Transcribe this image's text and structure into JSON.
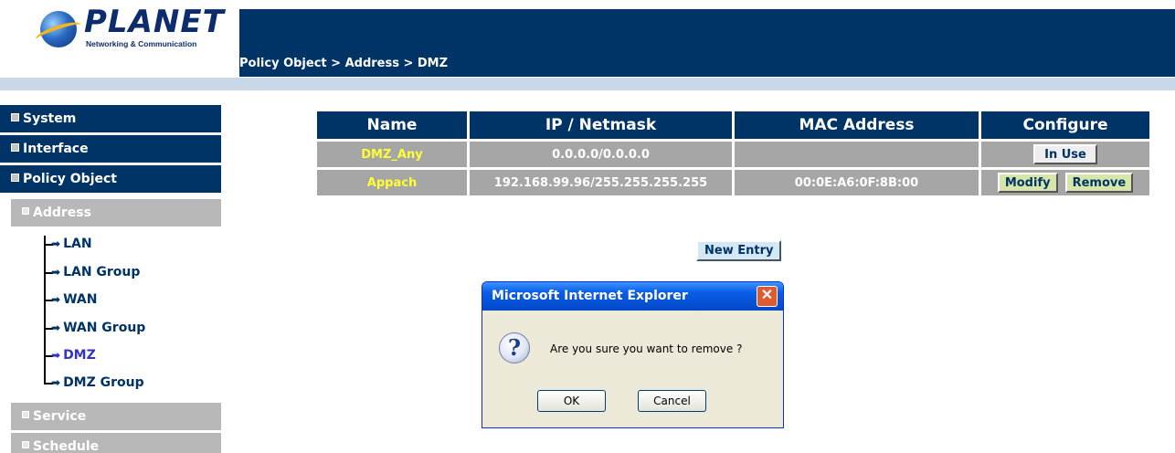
{
  "logo": {
    "brand": "PLANET",
    "tagline": "Networking & Communication"
  },
  "header": {
    "breadcrumb": "Policy Object > Address > DMZ"
  },
  "sidebar": {
    "main_items": [
      {
        "label": "System"
      },
      {
        "label": "Interface"
      },
      {
        "label": "Policy Object"
      }
    ],
    "sub_items": [
      {
        "label": "Address"
      },
      {
        "label": "Service"
      },
      {
        "label": "Schedule"
      }
    ],
    "tree_items": [
      {
        "label": "LAN"
      },
      {
        "label": "LAN Group"
      },
      {
        "label": "WAN"
      },
      {
        "label": "WAN Group"
      },
      {
        "label": "DMZ"
      },
      {
        "label": "DMZ Group"
      }
    ],
    "active_item": "DMZ"
  },
  "table": {
    "headers": [
      "Name",
      "IP / Netmask",
      "MAC Address",
      "Configure"
    ],
    "rows": [
      {
        "name": "DMZ_Any",
        "ip": "0.0.0.0/0.0.0.0",
        "mac": "",
        "buttons": [
          "In Use"
        ]
      },
      {
        "name": "Appach",
        "ip": "192.168.99.96/255.255.255.255",
        "mac": "00:0E:A6:0F:8B:00",
        "buttons": [
          "Modify",
          "Remove"
        ]
      }
    ]
  },
  "new_entry_label": "New Entry",
  "dialog": {
    "title": "Microsoft Internet Explorer",
    "message": "Are you sure you want to remove ?",
    "ok_label": "OK",
    "cancel_label": "Cancel",
    "close_glyph": "✕",
    "icon": "question-icon"
  },
  "colors": {
    "navy": "#003366",
    "row_gray": "#a6a6a6",
    "name_yellow": "#ffff33",
    "active_link": "#3333cc"
  }
}
